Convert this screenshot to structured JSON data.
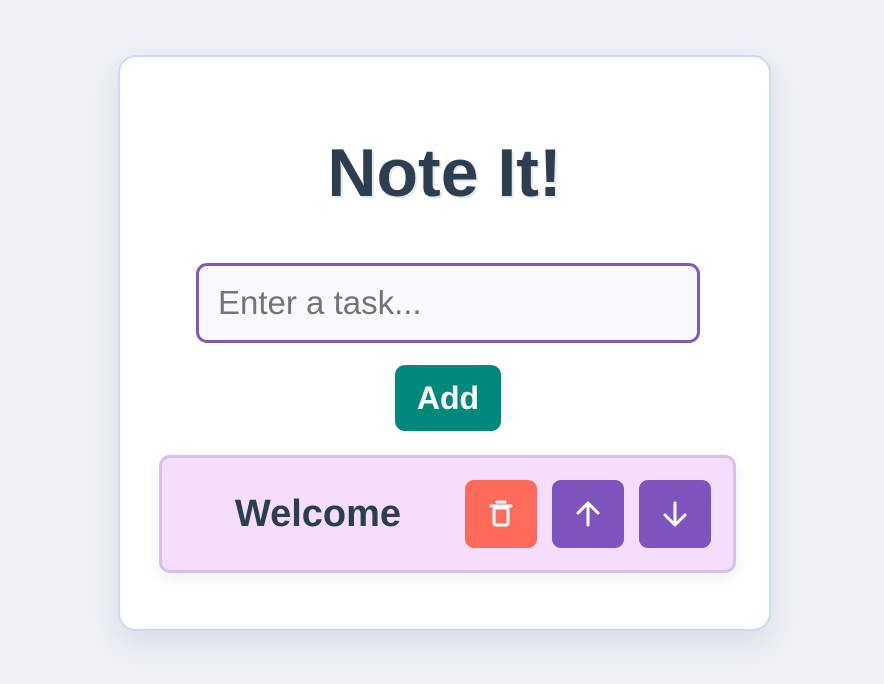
{
  "app": {
    "title": "Note It!"
  },
  "input": {
    "placeholder": "Enter a task...",
    "value": ""
  },
  "add_button": {
    "label": "Add"
  },
  "tasks": [
    {
      "text": "Welcome",
      "actions": [
        {
          "name": "delete",
          "icon": "trash-icon",
          "color": "#ff6b5b"
        },
        {
          "name": "move-up",
          "icon": "arrow-up-icon",
          "color": "#7f54bf"
        },
        {
          "name": "move-down",
          "icon": "arrow-down-icon",
          "color": "#7f54bf"
        }
      ]
    }
  ],
  "colors": {
    "page_background": "#edf1f6",
    "title": "#2c3e50",
    "input_border": "#8158b4",
    "add_button": "#00897b",
    "task_background": "#f4defc"
  }
}
